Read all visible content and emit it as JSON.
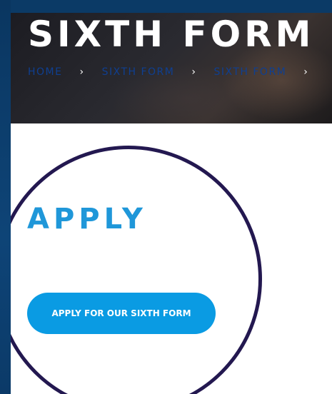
{
  "hero": {
    "title": "SIXTH FORM",
    "breadcrumb": [
      {
        "label": "HOME"
      },
      {
        "label": "SIXTH FORM"
      },
      {
        "label": "SIXTH FORM"
      }
    ],
    "separator": "›"
  },
  "main": {
    "heading": "APPLY",
    "button_label": "APPLY FOR OUR SIXTH FORM"
  },
  "colors": {
    "frame": "#0c3a66",
    "heading": "#1f97d9",
    "button": "#0a9be3",
    "breadcrumb": "#0f3f91",
    "highlight_ring": "#231850"
  }
}
